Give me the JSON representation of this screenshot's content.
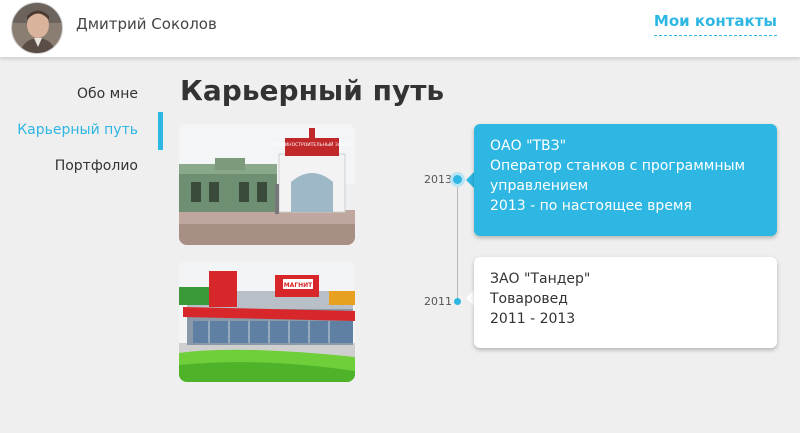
{
  "header": {
    "user_name": "Дмитрий Соколов",
    "contacts_label": "Мои контакты"
  },
  "nav": {
    "items": [
      {
        "label": "Обо мне",
        "active": false
      },
      {
        "label": "Карьерный путь",
        "active": true
      },
      {
        "label": "Портфолио",
        "active": false
      }
    ]
  },
  "main": {
    "title": "Карьерный путь",
    "photos": [
      {
        "name": "factory-photo",
        "sign_text": "МАШИНОСТРОИТЕЛЬНЫЙ ЗАВОД"
      },
      {
        "name": "store-photo",
        "sign_text": "МАГНИТ"
      }
    ],
    "timeline": [
      {
        "year": "2013",
        "company": "ОАО \"ТВЗ\"",
        "position": "Оператор станков с программным управлением",
        "period": "2013 - по настоящее время",
        "highlighted": true
      },
      {
        "year": "2011",
        "company": "ЗАО \"Тандер\"",
        "position": "Товаровед",
        "period": "2011 - 2013",
        "highlighted": false
      }
    ]
  },
  "colors": {
    "accent": "#2fb7e3",
    "background": "#efefef",
    "card": "#ffffff",
    "text": "#333333"
  }
}
